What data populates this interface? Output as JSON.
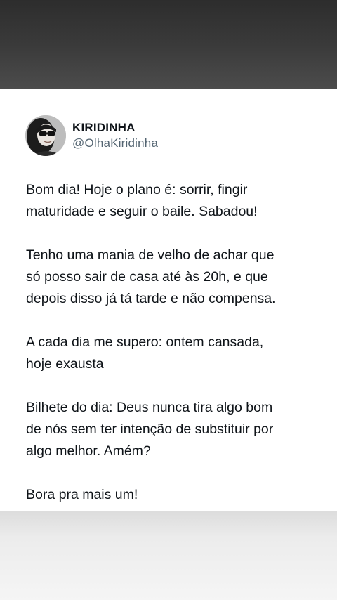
{
  "post": {
    "display_name": "KIRIDINHA",
    "handle": "@OlhaKiridinha",
    "avatar_icon": "profile-photo",
    "paragraphs": [
      "Bom dia! Hoje o plano é: sorrir, fingir\nmaturidade e seguir o baile. Sabadou!",
      "Tenho uma mania de velho de achar que\nsó posso sair de casa até às 20h, e que\ndepois disso já tá tarde e não compensa.",
      "A cada dia me supero: ontem cansada,\nhoje exausta",
      "Bilhete do dia: Deus nunca tira algo bom\nde nós sem ter intenção de substituir por\nalgo melhor. Amém?",
      "Bora pra mais um!"
    ]
  },
  "colors": {
    "text": "#0f1419",
    "handle": "#536471",
    "card_bg": "#ffffff",
    "top_band": "#2d2d2d"
  }
}
